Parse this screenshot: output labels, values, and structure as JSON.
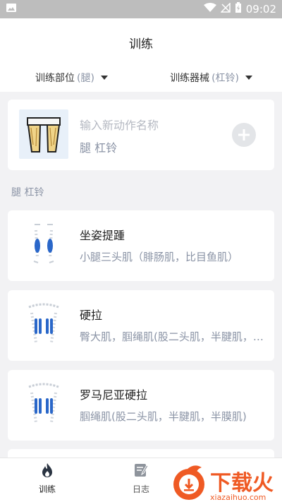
{
  "status_bar": {
    "time": "09:02",
    "icons": [
      "image-icon",
      "wifi-icon",
      "no-signal-icon",
      "battery-charging-icon"
    ]
  },
  "header": {
    "title": "训练",
    "filter_part": {
      "label": "训练部位",
      "value": "(腿)"
    },
    "filter_equipment": {
      "label": "训练器械",
      "value": "(杠铃)"
    }
  },
  "new_action": {
    "placeholder": "输入新动作名称",
    "subtitle": "腿 杠铃",
    "add_icon": "plus-icon"
  },
  "section_label": "腿 杠铃",
  "exercises": [
    {
      "name": "坐姿提踵",
      "muscles": "小腿三头肌（腓肠肌，比目鱼肌）"
    },
    {
      "name": "硬拉",
      "muscles": "臀大肌，腘绳肌(股二头肌，半腱肌，半膜肌)"
    },
    {
      "name": "罗马尼亚硬拉",
      "muscles": "腘绳肌(股二头肌，半腱肌，半膜肌)"
    }
  ],
  "bottom_nav": {
    "train": {
      "label": "训练",
      "icon": "flame-icon"
    },
    "log": {
      "label": "日志",
      "icon": "notepad-icon"
    }
  },
  "watermark": {
    "text": "下载火",
    "subtext": "xiazaihuo.com"
  },
  "colors": {
    "accent_gray": "#8a93a5",
    "muscle_blue": "#2a67c9",
    "background": "#f2f2f4",
    "watermark_orange": "#ef5a24"
  }
}
